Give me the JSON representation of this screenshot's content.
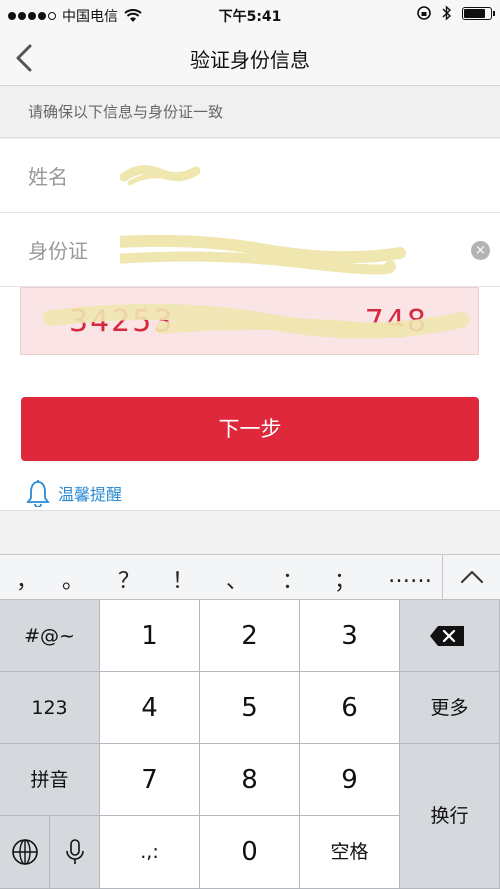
{
  "status_bar": {
    "carrier": "中国电信",
    "time": "下午5:41",
    "battery_level": 0.85
  },
  "nav": {
    "title": "验证身份信息"
  },
  "form": {
    "hint": "请确保以下信息与身份证一致",
    "name_label": "姓名",
    "id_label": "身份证",
    "clear_symbol": "×"
  },
  "id_preview": {
    "start": "34253",
    "end": "748"
  },
  "actions": {
    "next_label": "下一步",
    "tips_label": "温馨提醒"
  },
  "keyboard": {
    "punctuation": [
      "，",
      "。",
      "？",
      "！",
      "、",
      "：",
      "；",
      "……"
    ],
    "rows": [
      {
        "fn": "#@~",
        "digits": [
          "1",
          "2",
          "3"
        ]
      },
      {
        "fn": "123",
        "digits": [
          "4",
          "5",
          "6"
        ],
        "right": "更多"
      },
      {
        "fn": "拼音",
        "digits": [
          "7",
          "8",
          "9"
        ]
      }
    ],
    "return_label": "换行",
    "comma_dot": ".,:",
    "zero": "0",
    "space_label": "空格"
  },
  "colors": {
    "accent": "#e0283d",
    "link": "#2a8ad3",
    "preview_bg": "#fbe4e6"
  }
}
